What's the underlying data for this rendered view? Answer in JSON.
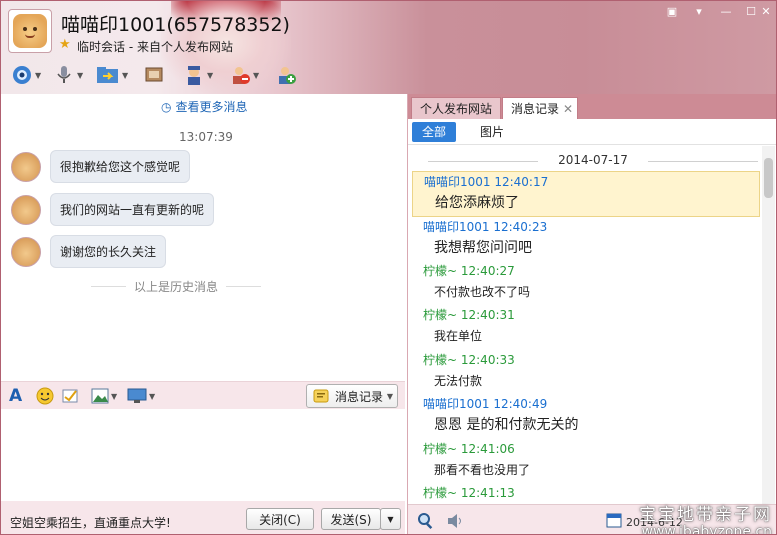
{
  "window": {
    "title": "喵喵印1001(657578352)",
    "subtitle": "临时会话 - 来自个人发布网站",
    "controls": [
      "▣",
      "▾",
      "—",
      "☐",
      "✕"
    ]
  },
  "toolbar": {
    "icons": [
      "camera-icon",
      "microphone-icon",
      "file-transfer-icon",
      "screen-share-icon",
      "avatar-icon",
      "remove-user-icon",
      "add-user-icon"
    ]
  },
  "chat": {
    "more_messages": "查看更多消息",
    "time": "13:07:39",
    "messages": [
      {
        "text": "很抱歉给您这个感觉呢"
      },
      {
        "text": "我们的网站一直有更新的呢"
      },
      {
        "text": "谢谢您的长久关注"
      }
    ],
    "history_divider": "以上是历史消息",
    "history_button": "消息记录"
  },
  "bottom": {
    "ad_text": "空姐空乘招生，直通重点大学!",
    "close_button": "关闭(C)",
    "send_button": "发送(S)"
  },
  "right": {
    "tabs": [
      "个人发布网站",
      "消息记录"
    ],
    "subtabs": [
      "全部",
      "图片"
    ],
    "date": "2014-07-17",
    "entries": [
      {
        "sender": "喵喵印1001 12:40:17",
        "text": "给您添麻烦了",
        "side": "blue",
        "big": true,
        "selected": true
      },
      {
        "sender": "喵喵印1001 12:40:23",
        "text": "我想帮您问问吧",
        "side": "blue",
        "big": true
      },
      {
        "sender": "柠檬~ 12:40:27",
        "text": "不付款也改不了吗",
        "side": "green"
      },
      {
        "sender": "柠檬~ 12:40:31",
        "text": "我在单位",
        "side": "green"
      },
      {
        "sender": "柠檬~ 12:40:33",
        "text": "无法付款",
        "side": "green"
      },
      {
        "sender": "喵喵印1001 12:40:49",
        "text": "恩恩 是的和付款无关的",
        "side": "blue",
        "big": true
      },
      {
        "sender": "柠檬~ 12:41:06",
        "text": "那看不看也没用了",
        "side": "green"
      },
      {
        "sender": "柠檬~ 12:41:13",
        "text": "",
        "side": "green"
      }
    ],
    "partial_date": "2014-6-12"
  },
  "watermark": {
    "line1": "宝宝地带亲子网",
    "line2": "www.ibabyzone.cn"
  },
  "colors": {
    "accent_blue": "#1a6fd0",
    "sender_green": "#2a9a3a",
    "header_pink": "#c88d97"
  }
}
